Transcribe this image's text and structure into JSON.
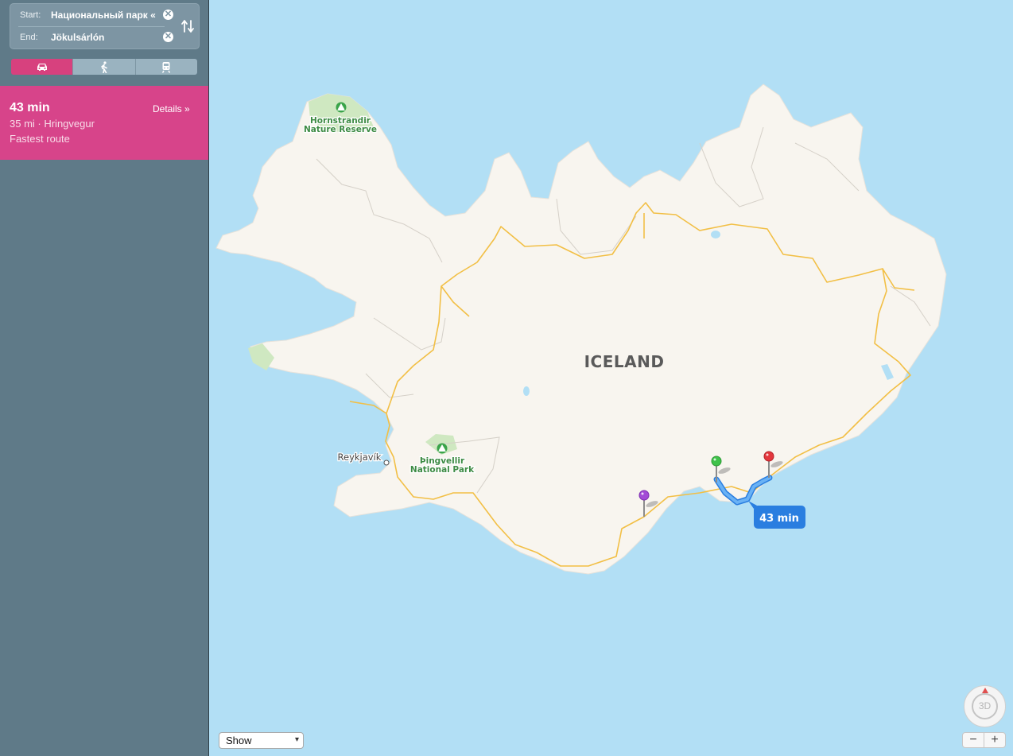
{
  "directions": {
    "start_label": "Start:",
    "start_value": "Национальный парк «",
    "end_label": "End:",
    "end_value": "Jökulsárlón",
    "clear_glyph": "✕",
    "swap_icon": "swap-arrows-icon",
    "modes": [
      {
        "name": "Driving",
        "icon": "car-icon",
        "active": true
      },
      {
        "name": "Walking",
        "icon": "walking-person-icon",
        "active": false
      },
      {
        "name": "Transit",
        "icon": "train-icon",
        "active": false
      }
    ]
  },
  "route": {
    "time": "43 min",
    "details_label": "Details »",
    "distance_road": "35 mi · Hringvegur",
    "note": "Fastest route"
  },
  "map": {
    "country_label": "ICELAND",
    "places": {
      "hornstrandir_line1": "Hornstrandir",
      "hornstrandir_line2": "Nature Reserve",
      "thingvellir_line1": "Þingvellir",
      "thingvellir_line2": "National Park",
      "reykjavik": "Reykjavík"
    },
    "route_badge": "43 min",
    "pins": [
      {
        "name": "start-pin",
        "color": "#3fc24a"
      },
      {
        "name": "end-pin",
        "color": "#e3373d"
      },
      {
        "name": "poi-pin",
        "color": "#a34bd6"
      }
    ],
    "colors": {
      "water": "#b2dff5",
      "land": "#f8f5ef",
      "road": "#f2bf45",
      "route": "#4a9bf0",
      "park": "#cfe8c1"
    }
  },
  "controls": {
    "show_label": "Show",
    "compass_label": "3D",
    "zoom_out": "−",
    "zoom_in": "+"
  }
}
